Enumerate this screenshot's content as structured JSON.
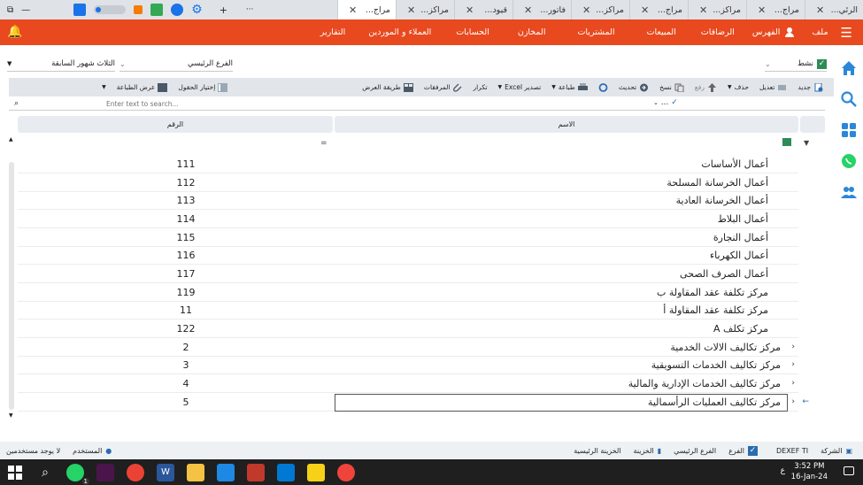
{
  "browser": {
    "tabs": [
      {
        "title": "الرئي...",
        "active": false
      },
      {
        "title": "مراج...",
        "active": false
      },
      {
        "title": "مراكز...",
        "active": false
      },
      {
        "title": "مراج...",
        "active": false
      },
      {
        "title": "مراكز...",
        "active": false
      },
      {
        "title": "فاتور...",
        "active": false
      },
      {
        "title": "قيود...",
        "active": false
      },
      {
        "title": "مراكز...",
        "active": false
      },
      {
        "title": "مراج...",
        "active": true
      }
    ],
    "new_tab": "+",
    "more": "···"
  },
  "menubar": {
    "file": "ملف",
    "index": "الفهرس",
    "sports": "الرضافات",
    "sales": "المبيعات",
    "purchases": "المشتريات",
    "stores": "المخازن",
    "accounts": "الحسابات",
    "clients_suppliers": "العملاء و الموردين",
    "reports": "التقارير"
  },
  "filters": {
    "active_label": "نشط",
    "branch_value": "الفرع الرئيسي",
    "period_value": "الثلاث شهور السابقة"
  },
  "toolbar": {
    "new": "جديد",
    "edit": "تعديل",
    "delete": "حذف",
    "up": "رفع",
    "copy": "نسخ",
    "refresh": "تحديث",
    "print": "طباعة",
    "export": "تصدير Excel",
    "repeat": "تكرار",
    "attachments": "المرفقات",
    "display_mode": "طريقة العرض",
    "choose_fields": "إختيار الحقول",
    "print_preview": "عرض الطباعة"
  },
  "search": {
    "placeholder": "Enter text to search...",
    "filter_value": "..."
  },
  "grid": {
    "col_name": "الاسم",
    "col_code": "الرقم",
    "rows": [
      {
        "name": "أعمال الأساسات",
        "code": "111",
        "expandable": false
      },
      {
        "name": "أعمال الخرسانة المسلحة",
        "code": "112",
        "expandable": false
      },
      {
        "name": "أعمال الخرسانة العادية",
        "code": "113",
        "expandable": false
      },
      {
        "name": "أعمال البلاط",
        "code": "114",
        "expandable": false
      },
      {
        "name": "أعمال النجارة",
        "code": "115",
        "expandable": false
      },
      {
        "name": "أعمال الكهرباء",
        "code": "116",
        "expandable": false
      },
      {
        "name": "أعمال الصرف الصحى",
        "code": "117",
        "expandable": false
      },
      {
        "name": "مركز تكلفة عقد المقاولة ب",
        "code": "119",
        "expandable": false
      },
      {
        "name": "مركز تكلفة عقد المقاولة أ",
        "code": "11",
        "expandable": false
      },
      {
        "name": "مركز تكلف A",
        "code": "122",
        "expandable": false
      },
      {
        "name": "مركز تكاليف الالات الخدمية",
        "code": "2",
        "expandable": true
      },
      {
        "name": "مركز تكاليف الخدمات التسويقية",
        "code": "3",
        "expandable": true
      },
      {
        "name": "مركز تكاليف الخدمات الإدارية والمالية",
        "code": "4",
        "expandable": true
      },
      {
        "name": "مركز تكاليف العمليات الرأسمالية",
        "code": "5",
        "expandable": true,
        "selected": true
      }
    ]
  },
  "status": {
    "company": "الشركة",
    "company_value": "DEXEF TI",
    "branch": "الفرع",
    "branch_value": "الفرع الرئيسي",
    "treasury": "الخزينة",
    "treasury_value": "الخزينة الرئيسية",
    "user": "المستخدم",
    "user_value": "لا يوجد مستخدمين"
  },
  "taskbar": {
    "time": "3:52 PM",
    "date": "16-Jan-24",
    "lang": "ع",
    "whatsapp_badge": "1"
  },
  "colors": {
    "brand": "#e8491f",
    "nav_icon": "#2b88d8",
    "whatsapp": "#25d366"
  }
}
